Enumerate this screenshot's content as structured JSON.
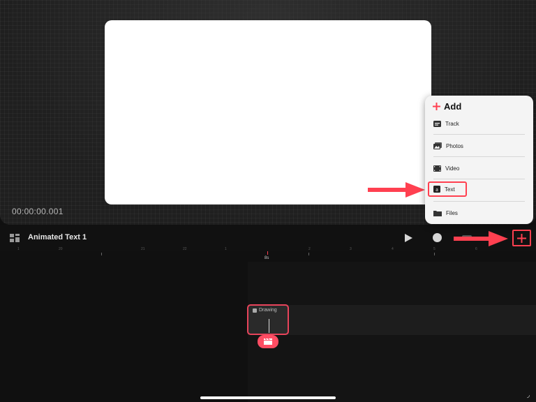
{
  "preview": {
    "timecode": "00:00:00.001"
  },
  "toolbar": {
    "project_title": "Animated Text 1"
  },
  "ruler": {
    "ticks": [
      "1",
      "20",
      "21",
      "22",
      "1",
      "2",
      "3",
      "4",
      "5",
      "6"
    ],
    "playhead_label": "8s"
  },
  "track": {
    "clip_label": "Drawing"
  },
  "add_menu": {
    "title": "Add",
    "items": [
      {
        "label": "Track",
        "icon": "track-icon"
      },
      {
        "label": "Photos",
        "icon": "photos-icon"
      },
      {
        "label": "Video",
        "icon": "video-icon"
      },
      {
        "label": "Text",
        "icon": "text-icon"
      },
      {
        "label": "Files",
        "icon": "folder-icon"
      }
    ]
  },
  "colors": {
    "accent": "#ff4050",
    "clip_border": "#e8445b"
  }
}
